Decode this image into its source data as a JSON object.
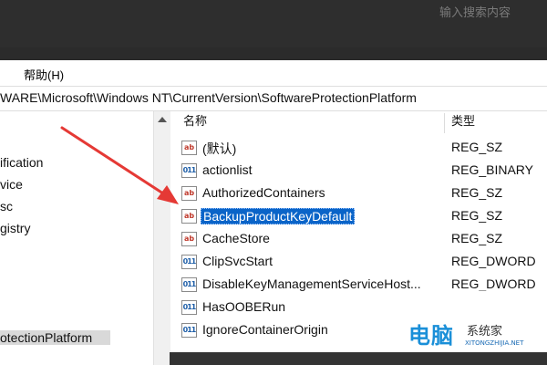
{
  "search": {
    "placeholder": "输入搜索内容"
  },
  "menu": {
    "help_label": "帮助(H)"
  },
  "address": {
    "path": "WARE\\Microsoft\\Windows NT\\CurrentVersion\\SoftwareProtectionPlatform"
  },
  "tree": {
    "items": [
      {
        "label": "ification"
      },
      {
        "label": "vice"
      },
      {
        "label": "sc"
      },
      {
        "label": "gistry"
      },
      {
        "label": "otectionPlatform"
      }
    ]
  },
  "list": {
    "header_name": "名称",
    "header_type": "类型",
    "rows": [
      {
        "name": "(默认)",
        "type": "REG_SZ",
        "icon": "string-value-icon"
      },
      {
        "name": "actionlist",
        "type": "REG_BINARY",
        "icon": "binary-value-icon"
      },
      {
        "name": "AuthorizedContainers",
        "type": "REG_SZ",
        "icon": "string-value-icon"
      },
      {
        "name": "BackupProductKeyDefault",
        "type": "REG_SZ",
        "icon": "string-value-icon"
      },
      {
        "name": "CacheStore",
        "type": "REG_SZ",
        "icon": "string-value-icon"
      },
      {
        "name": "ClipSvcStart",
        "type": "REG_DWORD",
        "icon": "binary-value-icon"
      },
      {
        "name": "DisableKeyManagementServiceHost...",
        "type": "REG_DWORD",
        "icon": "binary-value-icon"
      },
      {
        "name": "HasOOBERun",
        "type": "",
        "icon": "binary-value-icon"
      },
      {
        "name": "IgnoreContainerOrigin",
        "type": "",
        "icon": "binary-value-icon"
      }
    ],
    "selected_index": 3
  },
  "watermark": {
    "logo": "电脑",
    "title": "系统家",
    "url": "XITONGZHIJIA.NET"
  },
  "colors": {
    "selection": "#0a64c8",
    "arrow": "#e53935",
    "string_icon": "#c0392b",
    "binary_icon": "#1f5fa8"
  }
}
